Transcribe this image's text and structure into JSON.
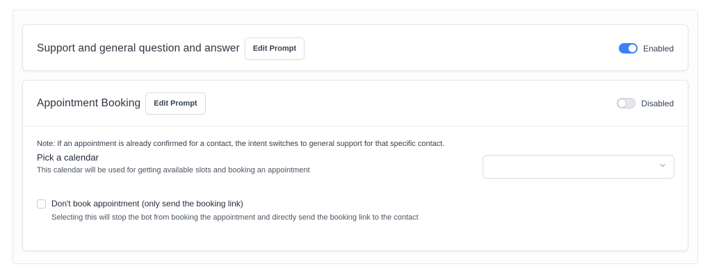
{
  "intents": [
    {
      "title": "Support and general question and answer",
      "edit_label": "Edit Prompt",
      "toggle_state": "on",
      "toggle_label": "Enabled"
    },
    {
      "title": "Appointment Booking",
      "edit_label": "Edit Prompt",
      "toggle_state": "off",
      "toggle_label": "Disabled",
      "note": "Note: If an appointment is already confirmed for a contact, the intent switches to general support for that specific contact.",
      "calendar": {
        "title": "Pick a calendar",
        "description": "This calendar will be used for getting available slots and booking an appointment",
        "selected_value": ""
      },
      "no_book": {
        "checked": false,
        "label": "Don't book appointment (only send the booking link)",
        "description": "Selecting this will stop the bot from booking the appointment and directly send the booking link to the contact"
      }
    }
  ],
  "colors": {
    "accent": "#3b82f6",
    "border": "#e5e7eb"
  },
  "icons": {
    "select_chevron": "chevron-down-icon"
  }
}
